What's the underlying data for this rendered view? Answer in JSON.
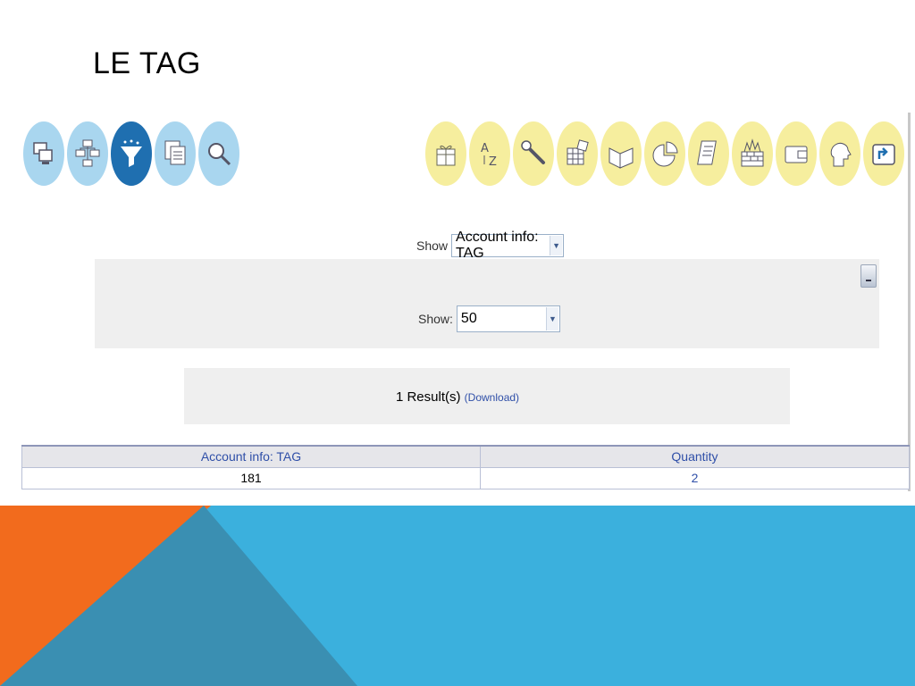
{
  "slide": {
    "title": "LE TAG"
  },
  "toolbar": {
    "left_icons": [
      "computers-icon",
      "hierarchy-icon",
      "filter-funnel-icon",
      "documents-icon",
      "magnifier-icon"
    ],
    "right_icons": [
      "gift-icon",
      "a-to-z-sort-icon",
      "wrench-icon",
      "grid-cube-icon",
      "book-icon",
      "pie-chart-icon",
      "scroll-icon",
      "firewall-icon",
      "wallet-icon",
      "profile-head-icon",
      "return-icon"
    ],
    "colors": {
      "left": "#a9d6ef",
      "left_active": "#1f6fb0",
      "right": "#f6ee9e"
    }
  },
  "view_selector": {
    "label": "Show",
    "value": "Account info: TAG"
  },
  "filter": {
    "label": "Show:",
    "value": "50"
  },
  "results": {
    "count_text": "1 Result(s)",
    "download_label": "(Download)"
  },
  "table": {
    "headers": [
      "Account info: TAG",
      "Quantity"
    ],
    "rows": [
      [
        "181",
        "2"
      ]
    ]
  },
  "theme": {
    "orange": "#f26b1d",
    "teal": "#3a8fb2",
    "sky": "#3bb0dd"
  }
}
